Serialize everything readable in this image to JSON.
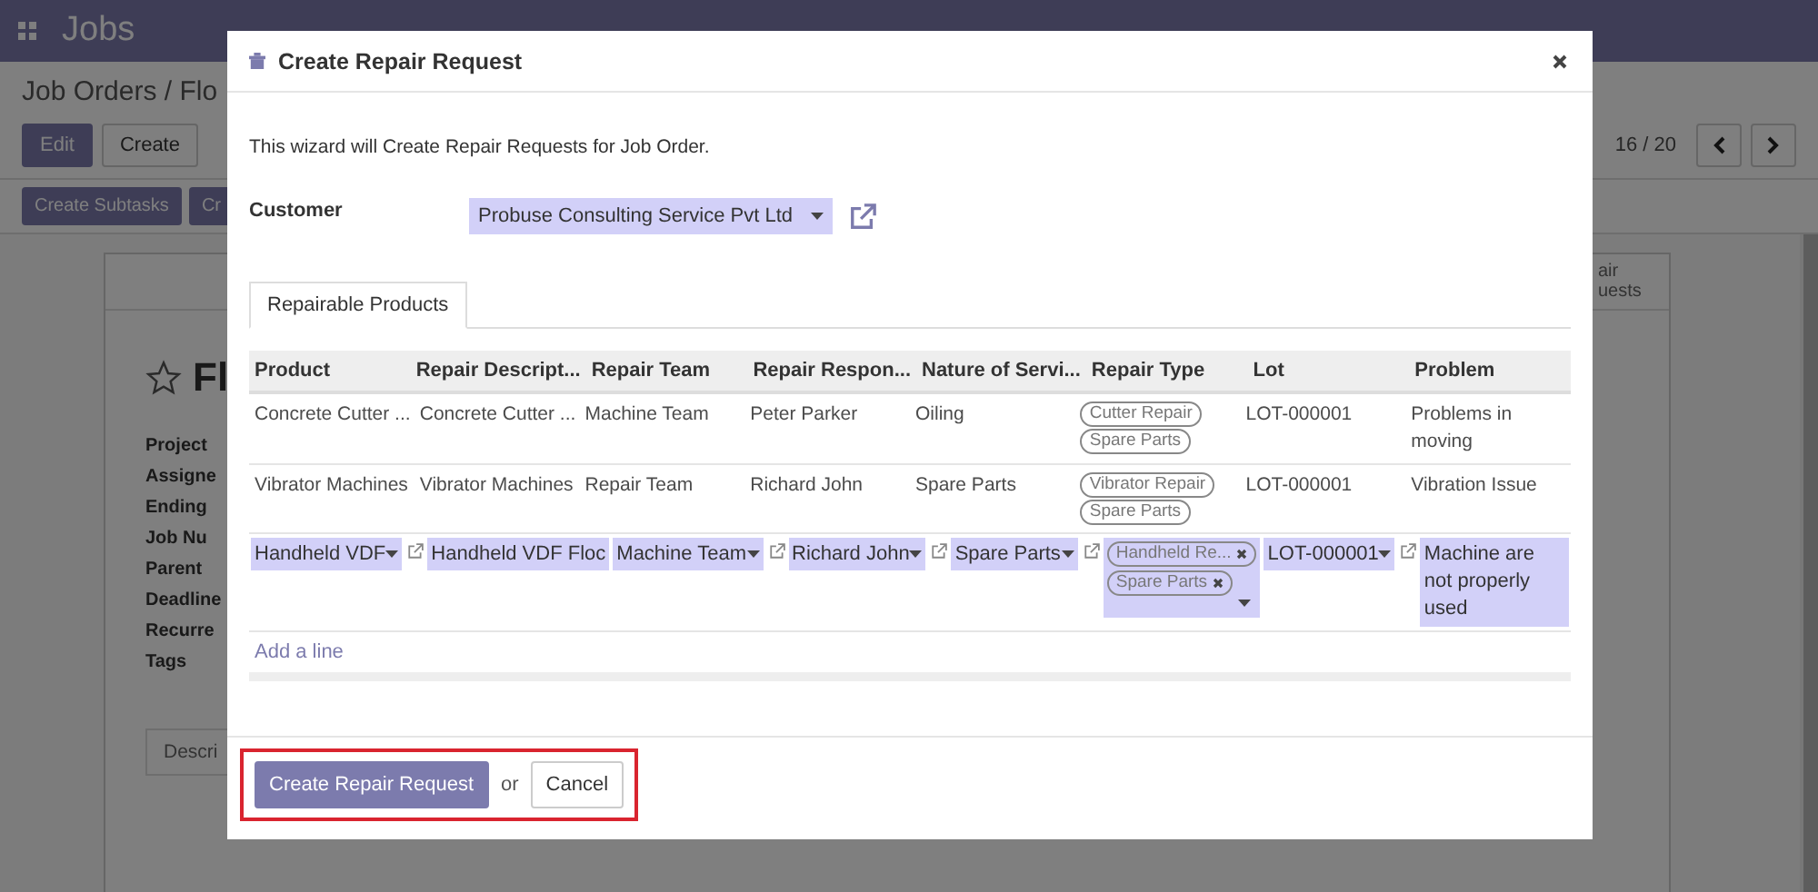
{
  "navbar": {
    "app_title": "Jobs"
  },
  "breadcrumb": "Job Orders / Flo",
  "actions": [
    "Edit",
    "Create"
  ],
  "pager": "16 / 20",
  "status_buttons": [
    "Create Subtasks",
    "Cr"
  ],
  "sheet": {
    "title": "Fl",
    "starred": false,
    "smart_button": [
      "air",
      "uests"
    ],
    "labels": [
      "Project",
      "Assigne",
      "Ending",
      "Job Nu",
      "Parent",
      "Deadline",
      "Recurre",
      "Tags"
    ],
    "tab": "Descri"
  },
  "dialog": {
    "title": "Create Repair Request",
    "intro": "This wizard will Create Repair Requests for Job Order.",
    "customer_label": "Customer",
    "customer": "Probuse Consulting Service Pvt Ltd",
    "tabs": [
      {
        "label": "Repairable Products",
        "selected": true
      }
    ],
    "columns": [
      "Product",
      "Repair Descript...",
      "Repair Team",
      "Repair Respon...",
      "Nature of Servi...",
      "Repair Type",
      "Lot",
      "Problem"
    ],
    "rows": [
      {
        "editing": false,
        "product": "Concrete Cutter ...",
        "description": "Concrete Cutter ...",
        "team": "Machine Team",
        "responsible": "Peter Parker",
        "nature": "Oiling",
        "repair_types": [
          "Cutter Repair",
          "Spare Parts"
        ],
        "lot": "LOT-000001",
        "problem": "Problems in moving"
      },
      {
        "editing": false,
        "product": "Vibrator Machines",
        "description": "Vibrator Machines",
        "team": "Repair Team",
        "responsible": "Richard John",
        "nature": "Spare Parts",
        "repair_types": [
          "Vibrator Repair",
          "Spare Parts"
        ],
        "lot": "LOT-000001",
        "problem": "Vibration Issue"
      },
      {
        "editing": true,
        "product": "Handheld VDF",
        "description": "Handheld VDF Floc",
        "team": "Machine Team",
        "responsible": "Richard John",
        "nature": "Spare Parts",
        "repair_types": [
          "Handheld Re...",
          "Spare Parts"
        ],
        "lot": "LOT-000001",
        "problem": "Machine are not properly used"
      }
    ],
    "add_line": "Add a line",
    "submit": "Create Repair Request",
    "or": "or",
    "cancel": "Cancel",
    "highlighted": true
  }
}
